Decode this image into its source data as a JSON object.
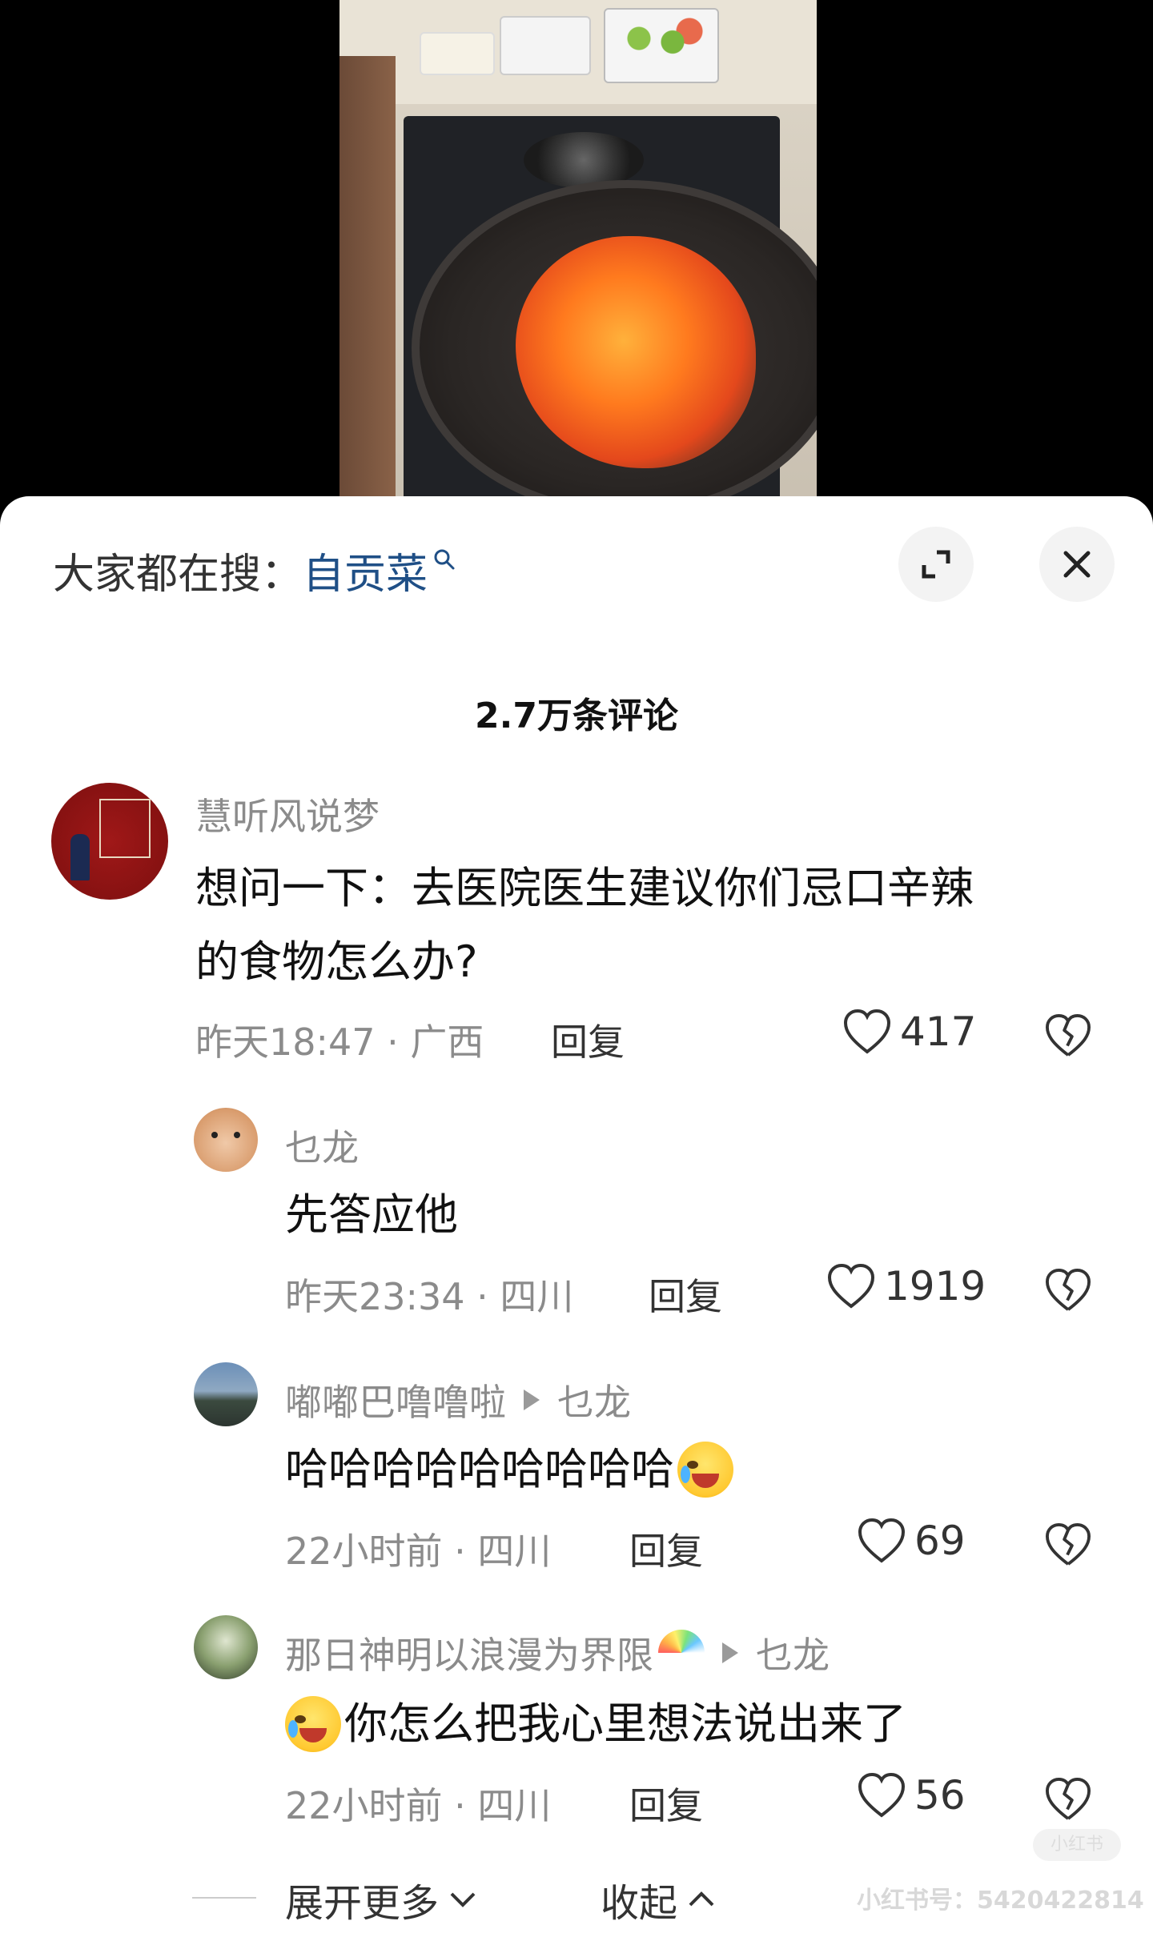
{
  "header": {
    "search_prefix": "大家都在搜：",
    "search_term": "自贡菜"
  },
  "comments_title": "2.7万条评论",
  "comments": [
    {
      "username": "慧听风说梦",
      "text_line1": "想问一下：去医院医生建议你们忌口辛辣",
      "text_line2": "的食物怎么办?",
      "time_location": "昨天18:47 · 广西",
      "reply_label": "回复",
      "likes": "417"
    },
    {
      "username": "乜龙",
      "text": "先答应他",
      "time_location": "昨天23:34 · 四川",
      "reply_label": "回复",
      "likes": "1919"
    },
    {
      "username": "嘟嘟巴噜噜啦",
      "reply_to": "乜龙",
      "text": "哈哈哈哈哈哈哈哈哈",
      "time_location": "22小时前 · 四川",
      "reply_label": "回复",
      "likes": "69"
    },
    {
      "username": "那日神明以浪漫为界限",
      "reply_to": "乜龙",
      "text": "你怎么把我心里想法说出来了",
      "time_location": "22小时前 · 四川",
      "reply_label": "回复",
      "likes": "56"
    }
  ],
  "footer": {
    "expand_label": "展开更多",
    "collapse_label": "收起",
    "watermark": "小红书号：5420422814",
    "watermark_badge": "小红书"
  },
  "icons": {
    "search_icon": "search-icon",
    "expand_icon": "expand-icon",
    "close_icon": "close-icon",
    "like_icon": "heart-icon",
    "dislike_icon": "broken-heart-icon"
  }
}
